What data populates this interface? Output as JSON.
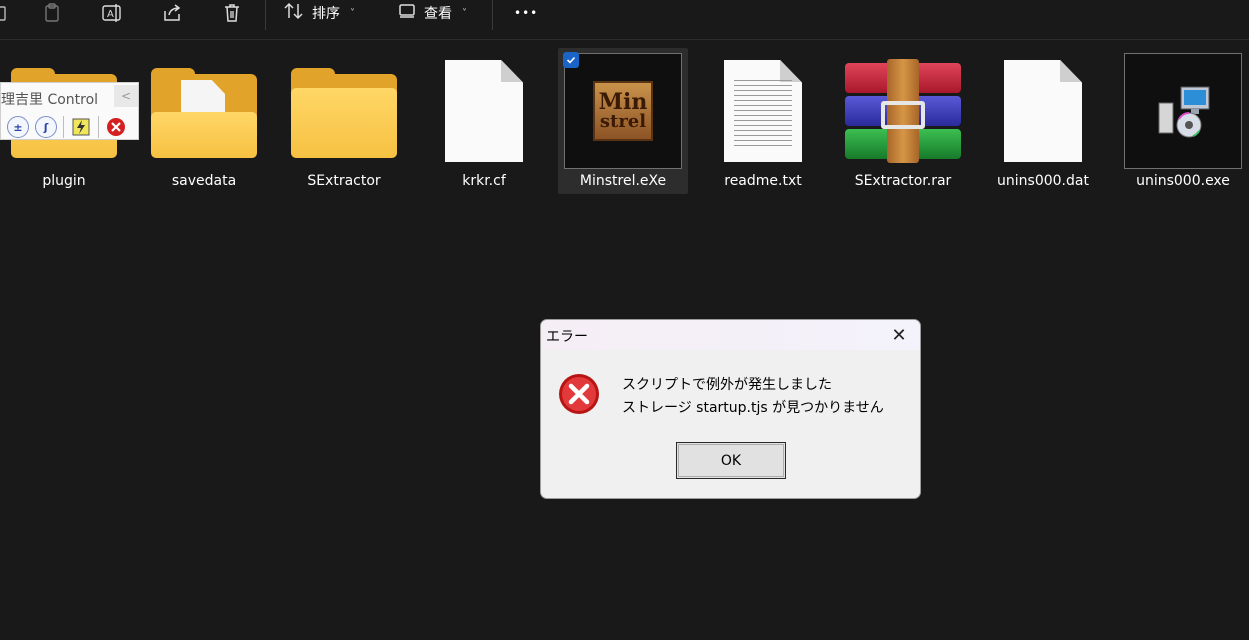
{
  "toolbar": {
    "sort_label": "排序",
    "view_label": "查看",
    "more_label": "•••"
  },
  "files": [
    {
      "name": "plugin",
      "kind": "folder"
    },
    {
      "name": "savedata",
      "kind": "folder-with-doc"
    },
    {
      "name": "SExtractor",
      "kind": "folder"
    },
    {
      "name": "krkr.cf",
      "kind": "document"
    },
    {
      "name": "Minstrel.eXe",
      "kind": "exe-minstrel",
      "selected": true
    },
    {
      "name": "readme.txt",
      "kind": "text-document"
    },
    {
      "name": "SExtractor.rar",
      "kind": "rar-archive"
    },
    {
      "name": "unins000.dat",
      "kind": "document"
    },
    {
      "name": "unins000.exe",
      "kind": "installer-exe"
    }
  ],
  "minstrel_icon": {
    "line1": "Min",
    "line2": "strel"
  },
  "control_widget": {
    "title": "理吉里 Control",
    "close": "<"
  },
  "dialog": {
    "title": "エラー",
    "message_line1": "スクリプトで例外が発生しました",
    "message_line2": "ストレージ startup.tjs が見つかりません",
    "ok_label": "OK"
  },
  "colors": {
    "background": "#191919",
    "folder": "#f6c142",
    "selection": "#2d2d2d",
    "checkbox": "#1a63c7",
    "error_red": "#d42020"
  }
}
